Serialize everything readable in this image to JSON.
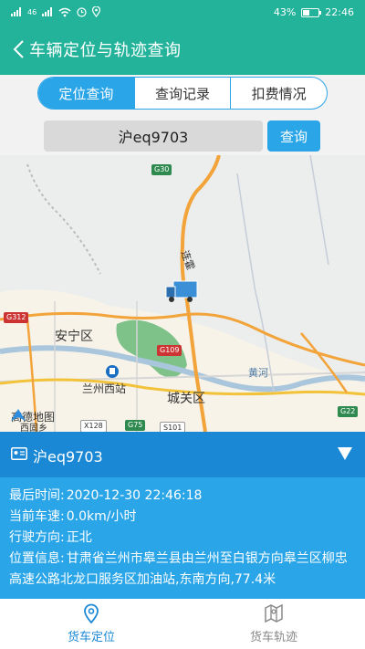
{
  "status_bar": {
    "signal_left": "46",
    "battery": "43%",
    "time": "22:46"
  },
  "header": {
    "title": "车辆定位与轨迹查询",
    "back_icon": "chevron-left-icon"
  },
  "tabs": [
    {
      "label": "定位查询",
      "active": true
    },
    {
      "label": "查询记录",
      "active": false
    },
    {
      "label": "扣费情况",
      "active": false
    }
  ],
  "search": {
    "value": "沪eq9703",
    "button_label": "查询"
  },
  "map": {
    "labels": {
      "anning": "安宁区",
      "lanzhou_west": "兰州西站",
      "chengguan": "城关区",
      "yellow_river": "黄河",
      "lian": "连霍",
      "xigu": "西固乡"
    },
    "roads": [
      "G30",
      "G312",
      "G109",
      "X128",
      "G75",
      "S101",
      "G22"
    ],
    "logo": "高德地图",
    "colors": {
      "highway": "#f2a33a",
      "river": "#a9c6dc",
      "park": "#7ec28a"
    }
  },
  "info": {
    "plate": "沪eq9703",
    "last_time_label": "最后时间:",
    "last_time": "2020-12-30 22:46:18",
    "speed_label": "当前车速:",
    "speed": "0.0km/小时",
    "direction_label": "行驶方向:",
    "direction": "正北",
    "location_label": "位置信息:",
    "location": "甘肃省兰州市皋兰县由兰州至白银方向皋兰区柳忠高速公路北龙口服务区加油站,东南方向,77.4米"
  },
  "bottom_nav": [
    {
      "label": "货车定位",
      "active": true
    },
    {
      "label": "货车轨迹",
      "active": false
    }
  ]
}
